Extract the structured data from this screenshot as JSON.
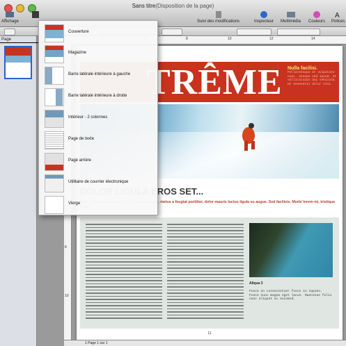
{
  "window": {
    "title": "Sans titre",
    "subtitle": "(Disposition de la page)",
    "colors": {
      "accent_red": "#c8321e",
      "selection_blue": "#2d64c8"
    }
  },
  "toolbar": {
    "affichage": "Affichage",
    "suivi": "Suivi des modifications",
    "inspecteur": "Inspecteur",
    "multimedia": "Multimédia",
    "couleurs": "Couleurs",
    "polices": "Polices"
  },
  "sidebar": {
    "label": "Page"
  },
  "menu": {
    "items": [
      {
        "label": "Couverture",
        "icon": "cover-template-icon"
      },
      {
        "label": "Magazine",
        "icon": "magazine-template-icon"
      },
      {
        "label": "Barre latérale intérieure à gauche",
        "icon": "left-sidebar-template-icon"
      },
      {
        "label": "Barre latérale intérieure à droite",
        "icon": "right-sidebar-template-icon"
      },
      {
        "label": "Intérieur - 2 colonnes",
        "icon": "two-columns-template-icon"
      },
      {
        "label": "Page de texte",
        "icon": "text-page-template-icon"
      },
      {
        "label": "Page arrière",
        "icon": "back-page-template-icon"
      },
      {
        "label": "Utilitaire de courrier électronique",
        "icon": "email-template-icon"
      },
      {
        "label": "Vierge",
        "icon": "blank-template-icon"
      }
    ]
  },
  "document": {
    "headline": "TRÊME",
    "sidebox_title": "Nulla facilisi.",
    "sidebox_text": "Pellentesque et vulputate nunc. Aenean sed ipsum. Ut sollicitudin dui vehicula. Ut venenatis dolor nisi.",
    "subhead": "DOLOR LIGULA EROS SET...",
    "deck": "Duis. Donec ac sapien. Ut orci. Duis ultricies, metus a feugiat porttitor, dolor mauris luctus ligula eu augue. Sed facilisis. Morbi lorem mi, tristique vitae.",
    "caption_title": "Aliqua 3",
    "caption_text": "Fusce in consectetuer fusce in sapien. Fusce nunc magna eget lacus. Maecenas felis nunc aliquet ac euismod.",
    "page_number": "11"
  },
  "status": {
    "text": "1    Page 1 sur 1"
  }
}
